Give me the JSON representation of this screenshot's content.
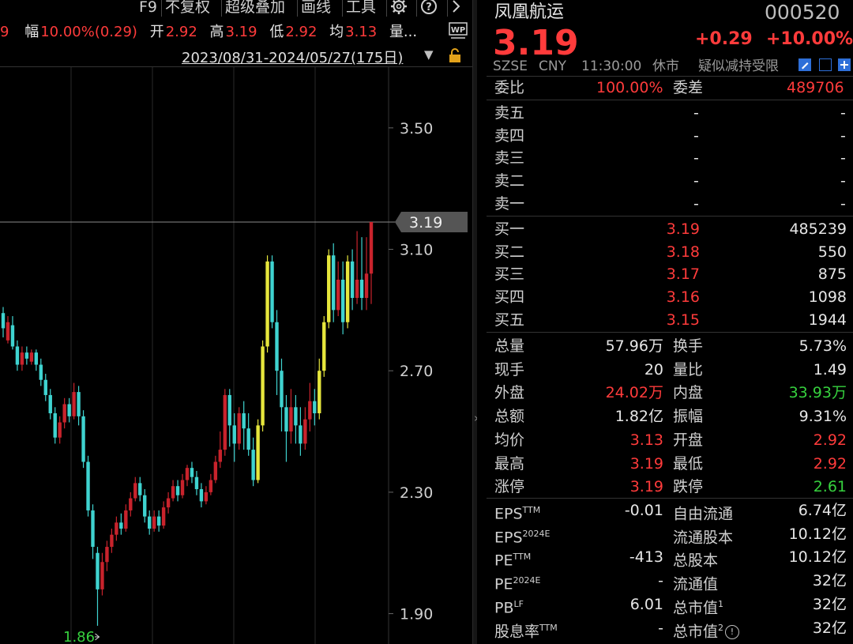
{
  "toolbar": {
    "items": [
      "F9",
      "不复权",
      "超级叠加",
      "画线",
      "工具"
    ],
    "gear_icon": "gear-icon",
    "help_icon": "help-icon",
    "next_icon": "chevron-right-icon"
  },
  "quote_strip": {
    "cut_value": "9",
    "change_pct_label": "幅",
    "change_pct_value": "10.00%(0.29)",
    "open_label": "开",
    "open_value": "2.92",
    "high_label": "高",
    "high_value": "3.19",
    "low_label": "低",
    "low_value": "2.92",
    "avg_label": "均",
    "avg_value": "3.13",
    "volume_label": "量...",
    "wp_badge": "WP"
  },
  "range": {
    "text": "2023/08/31-2024/05/27(175日)",
    "caret": "▼"
  },
  "chart_data": {
    "type": "candlestick",
    "ylim": [
      1.8,
      3.7
    ],
    "y_ticks": [
      "3.50",
      "3.10",
      "2.70",
      "2.30",
      "1.90"
    ],
    "y_tick_values": [
      3.5,
      3.1,
      2.7,
      2.3,
      1.9
    ],
    "last_price_label": "3.19",
    "last_price": 3.19,
    "min_label": "1.86",
    "min_value": 1.86,
    "up_color": "#c8232c",
    "down_color": "#3fd3d0",
    "limit_up_color": "#e6e63c",
    "candles": [
      [
        2.84,
        2.89,
        2.81,
        2.91,
        "d"
      ],
      [
        2.8,
        2.86,
        2.79,
        2.88,
        "u"
      ],
      [
        2.85,
        2.78,
        2.77,
        2.88,
        "d"
      ],
      [
        2.78,
        2.72,
        2.7,
        2.8,
        "d"
      ],
      [
        2.72,
        2.76,
        2.7,
        2.78,
        "u"
      ],
      [
        2.76,
        2.74,
        2.72,
        2.78,
        "d"
      ],
      [
        2.73,
        2.76,
        2.72,
        2.77,
        "u"
      ],
      [
        2.76,
        2.72,
        2.7,
        2.77,
        "d"
      ],
      [
        2.72,
        2.67,
        2.65,
        2.74,
        "d"
      ],
      [
        2.67,
        2.62,
        2.6,
        2.69,
        "d"
      ],
      [
        2.62,
        2.56,
        2.54,
        2.64,
        "d"
      ],
      [
        2.56,
        2.48,
        2.46,
        2.58,
        "d"
      ],
      [
        2.48,
        2.53,
        2.46,
        2.55,
        "u"
      ],
      [
        2.53,
        2.59,
        2.51,
        2.61,
        "u"
      ],
      [
        2.59,
        2.55,
        2.53,
        2.61,
        "d"
      ],
      [
        2.55,
        2.63,
        2.54,
        2.66,
        "u"
      ],
      [
        2.63,
        2.55,
        2.52,
        2.65,
        "d"
      ],
      [
        2.55,
        2.4,
        2.38,
        2.57,
        "d"
      ],
      [
        2.4,
        2.24,
        2.22,
        2.42,
        "d"
      ],
      [
        2.24,
        2.12,
        2.08,
        2.26,
        "d"
      ],
      [
        2.1,
        1.98,
        1.86,
        2.12,
        "d"
      ],
      [
        1.98,
        2.07,
        1.96,
        2.1,
        "u"
      ],
      [
        2.07,
        2.12,
        2.04,
        2.14,
        "u"
      ],
      [
        2.12,
        2.16,
        2.1,
        2.18,
        "u"
      ],
      [
        2.16,
        2.2,
        2.14,
        2.22,
        "u"
      ],
      [
        2.2,
        2.18,
        2.16,
        2.23,
        "d"
      ],
      [
        2.18,
        2.24,
        2.17,
        2.26,
        "u"
      ],
      [
        2.24,
        2.28,
        2.22,
        2.3,
        "u"
      ],
      [
        2.28,
        2.33,
        2.27,
        2.35,
        "u"
      ],
      [
        2.33,
        2.29,
        2.27,
        2.35,
        "d"
      ],
      [
        2.29,
        2.22,
        2.2,
        2.31,
        "d"
      ],
      [
        2.22,
        2.18,
        2.16,
        2.24,
        "d"
      ],
      [
        2.18,
        2.22,
        2.17,
        2.24,
        "u"
      ],
      [
        2.22,
        2.19,
        2.17,
        2.24,
        "d"
      ],
      [
        2.19,
        2.25,
        2.18,
        2.27,
        "u"
      ],
      [
        2.25,
        2.28,
        2.23,
        2.3,
        "u"
      ],
      [
        2.28,
        2.32,
        2.27,
        2.34,
        "u"
      ],
      [
        2.32,
        2.29,
        2.27,
        2.34,
        "d"
      ],
      [
        2.29,
        2.34,
        2.28,
        2.36,
        "u"
      ],
      [
        2.34,
        2.38,
        2.32,
        2.39,
        "u"
      ],
      [
        2.38,
        2.35,
        2.33,
        2.4,
        "d"
      ],
      [
        2.35,
        2.31,
        2.29,
        2.37,
        "d"
      ],
      [
        2.31,
        2.27,
        2.25,
        2.33,
        "d"
      ],
      [
        2.27,
        2.3,
        2.26,
        2.32,
        "u"
      ],
      [
        2.3,
        2.34,
        2.29,
        2.36,
        "u"
      ],
      [
        2.34,
        2.4,
        2.33,
        2.42,
        "u"
      ],
      [
        2.4,
        2.44,
        2.38,
        2.5,
        "u"
      ],
      [
        2.44,
        2.62,
        2.42,
        2.64,
        "u"
      ],
      [
        2.62,
        2.52,
        2.45,
        2.64,
        "d"
      ],
      [
        2.52,
        2.46,
        2.4,
        2.56,
        "d"
      ],
      [
        2.46,
        2.56,
        2.44,
        2.58,
        "u"
      ],
      [
        2.56,
        2.51,
        2.44,
        2.6,
        "d"
      ],
      [
        2.51,
        2.44,
        2.42,
        2.56,
        "d"
      ],
      [
        2.44,
        2.34,
        2.32,
        2.48,
        "d"
      ],
      [
        2.34,
        2.52,
        2.33,
        2.54,
        "L"
      ],
      [
        2.52,
        2.78,
        2.5,
        2.8,
        "L"
      ],
      [
        2.78,
        3.06,
        2.76,
        3.08,
        "L"
      ],
      [
        3.06,
        2.86,
        2.84,
        3.08,
        "d"
      ],
      [
        2.86,
        2.7,
        2.62,
        2.9,
        "d"
      ],
      [
        2.7,
        2.58,
        2.5,
        2.74,
        "d"
      ],
      [
        2.58,
        2.5,
        2.4,
        2.62,
        "d"
      ],
      [
        2.5,
        2.58,
        2.46,
        2.64,
        "u"
      ],
      [
        2.58,
        2.52,
        2.46,
        2.62,
        "d"
      ],
      [
        2.52,
        2.46,
        2.42,
        2.58,
        "d"
      ],
      [
        2.46,
        2.54,
        2.44,
        2.58,
        "u"
      ],
      [
        2.54,
        2.6,
        2.5,
        2.66,
        "u"
      ],
      [
        2.6,
        2.56,
        2.52,
        2.64,
        "d"
      ],
      [
        2.56,
        2.7,
        2.54,
        2.74,
        "L"
      ],
      [
        2.7,
        2.86,
        2.68,
        2.88,
        "L"
      ],
      [
        2.86,
        3.08,
        2.84,
        3.1,
        "L"
      ],
      [
        3.08,
        2.9,
        2.86,
        3.12,
        "d"
      ],
      [
        2.9,
        3.0,
        2.88,
        3.06,
        "u"
      ],
      [
        3.0,
        2.86,
        2.82,
        3.06,
        "d"
      ],
      [
        2.86,
        3.06,
        2.84,
        3.08,
        "L"
      ],
      [
        3.06,
        2.94,
        2.9,
        3.1,
        "d"
      ],
      [
        2.94,
        3.0,
        2.92,
        3.16,
        "u"
      ],
      [
        3.0,
        2.94,
        2.9,
        3.14,
        "d"
      ],
      [
        2.94,
        3.02,
        2.9,
        3.14,
        "u"
      ],
      [
        3.02,
        3.19,
        2.92,
        3.19,
        "u"
      ]
    ]
  },
  "stock": {
    "name": "凤凰航运",
    "code": "000520",
    "price": "3.19",
    "change": "+0.29",
    "change_pct": "+10.00%",
    "exchange": "SZSE",
    "currency": "CNY",
    "time": "11:30:00",
    "status": "休市",
    "flag": "疑似减持受限"
  },
  "order_ratio": {
    "label": "委比",
    "value": "100.00%",
    "diff_label": "委差",
    "diff_value": "489706"
  },
  "asks": [
    {
      "label": "卖五",
      "price": "-",
      "vol": "-"
    },
    {
      "label": "卖四",
      "price": "-",
      "vol": "-"
    },
    {
      "label": "卖三",
      "price": "-",
      "vol": "-"
    },
    {
      "label": "卖二",
      "price": "-",
      "vol": "-"
    },
    {
      "label": "卖一",
      "price": "-",
      "vol": "-"
    }
  ],
  "bids": [
    {
      "label": "买一",
      "price": "3.19",
      "vol": "485239"
    },
    {
      "label": "买二",
      "price": "3.18",
      "vol": "550"
    },
    {
      "label": "买三",
      "price": "3.17",
      "vol": "875"
    },
    {
      "label": "买四",
      "price": "3.16",
      "vol": "1098"
    },
    {
      "label": "买五",
      "price": "3.15",
      "vol": "1944"
    }
  ],
  "stats": [
    {
      "l1": "总量",
      "v1": "57.96万",
      "c1": "white",
      "l2": "换手",
      "v2": "5.73%",
      "c2": "white"
    },
    {
      "l1": "现手",
      "v1": "20",
      "c1": "white",
      "l2": "量比",
      "v2": "1.49",
      "c2": "white"
    },
    {
      "l1": "外盘",
      "v1": "24.02万",
      "c1": "red",
      "l2": "内盘",
      "v2": "33.93万",
      "c2": "green"
    },
    {
      "l1": "总额",
      "v1": "1.82亿",
      "c1": "white",
      "l2": "振幅",
      "v2": "9.31%",
      "c2": "white"
    },
    {
      "l1": "均价",
      "v1": "3.13",
      "c1": "red",
      "l2": "开盘",
      "v2": "2.92",
      "c2": "red"
    },
    {
      "l1": "最高",
      "v1": "3.19",
      "c1": "red",
      "l2": "最低",
      "v2": "2.92",
      "c2": "red"
    },
    {
      "l1": "涨停",
      "v1": "3.19",
      "c1": "red",
      "l2": "跌停",
      "v2": "2.61",
      "c2": "green"
    }
  ],
  "fundamentals": [
    {
      "l1": "EPS",
      "s1": "TTM",
      "v1": "-0.01",
      "l2": "自由流通",
      "s2": "",
      "v2": "6.74亿"
    },
    {
      "l1": "EPS",
      "s1": "2024E",
      "v1": "",
      "l2": "流通股本",
      "s2": "",
      "v2": "10.12亿"
    },
    {
      "l1": "PE",
      "s1": "TTM",
      "v1": "-413",
      "l2": "总股本",
      "s2": "",
      "v2": "10.12亿"
    },
    {
      "l1": "PE",
      "s1": "2024E",
      "v1": "-",
      "l2": "流通值",
      "s2": "",
      "v2": "32亿"
    },
    {
      "l1": "PB",
      "s1": "LF",
      "v1": "6.01",
      "l2": "总市值",
      "s2": "1",
      "v2": "32亿"
    },
    {
      "l1": "股息率",
      "s1": "TTM",
      "v1": "-",
      "l2": "总市值",
      "s2": "2",
      "v2": "32亿"
    }
  ]
}
